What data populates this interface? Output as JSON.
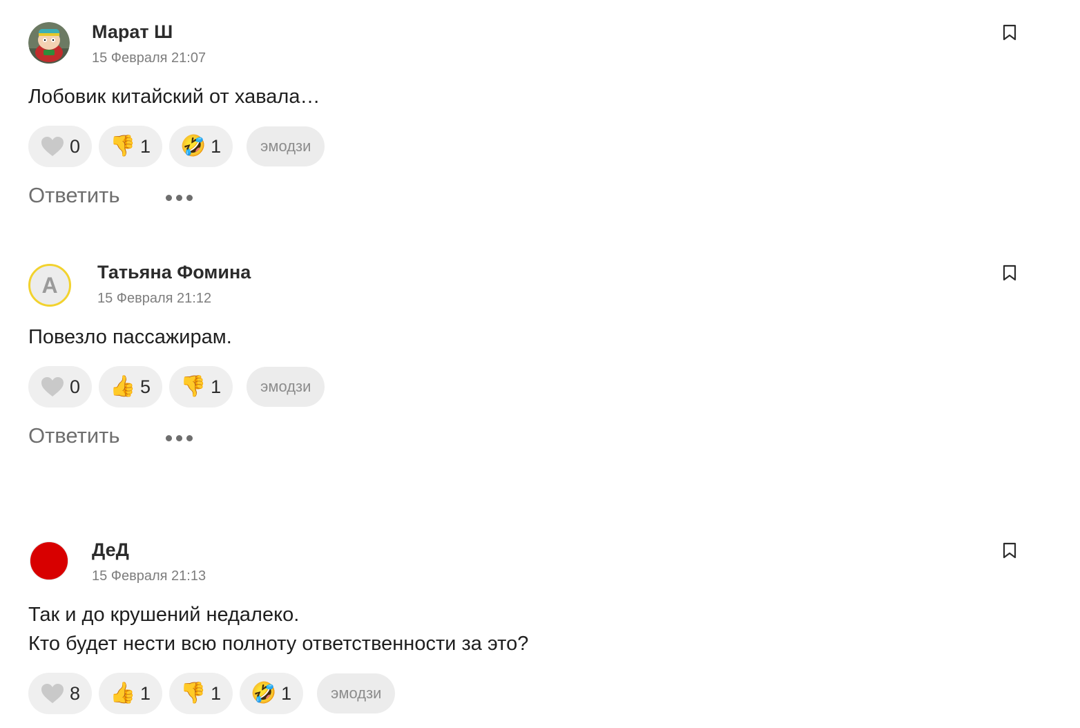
{
  "comments": [
    {
      "author": "Марат Ш",
      "date": "15 Февраля 21:07",
      "text": [
        "Лобовик китайский от хавала…"
      ],
      "avatar": "cartoon-avatar",
      "reactions": [
        {
          "icon": "heart-icon",
          "count": "0"
        },
        {
          "icon": "thumbs-down-icon",
          "count": "1"
        },
        {
          "icon": "rofl-icon",
          "count": "1"
        }
      ],
      "emoji_label": "эмодзи",
      "reply_label": "Ответить"
    },
    {
      "author": "Татьяна Фомина",
      "date": "15 Февраля 21:12",
      "text": [
        "Повезло пассажирам."
      ],
      "avatar_letter": "А",
      "reactions": [
        {
          "icon": "heart-icon",
          "count": "0"
        },
        {
          "icon": "thumbs-up-icon",
          "count": "5"
        },
        {
          "icon": "thumbs-down-icon",
          "count": "1"
        }
      ],
      "emoji_label": "эмодзи",
      "reply_label": "Ответить"
    },
    {
      "author": "ДеД",
      "date": "15 Февраля 21:13",
      "text": [
        "Так и до крушений недалеко.",
        "Кто будет нести всю полноту ответственности за это?"
      ],
      "avatar": "red-circle-avatar",
      "reactions": [
        {
          "icon": "heart-icon",
          "count": "8"
        },
        {
          "icon": "thumbs-up-icon",
          "count": "1"
        },
        {
          "icon": "thumbs-down-icon",
          "count": "1"
        },
        {
          "icon": "rofl-icon",
          "count": "1"
        }
      ],
      "emoji_label": "эмодзи"
    }
  ],
  "colors": {
    "pill_bg": "#efefef",
    "text": "#1e1e1e",
    "muted": "#7d7d7d",
    "avatar_ring": "#f2d22e",
    "avatar_red": "#d80000"
  }
}
